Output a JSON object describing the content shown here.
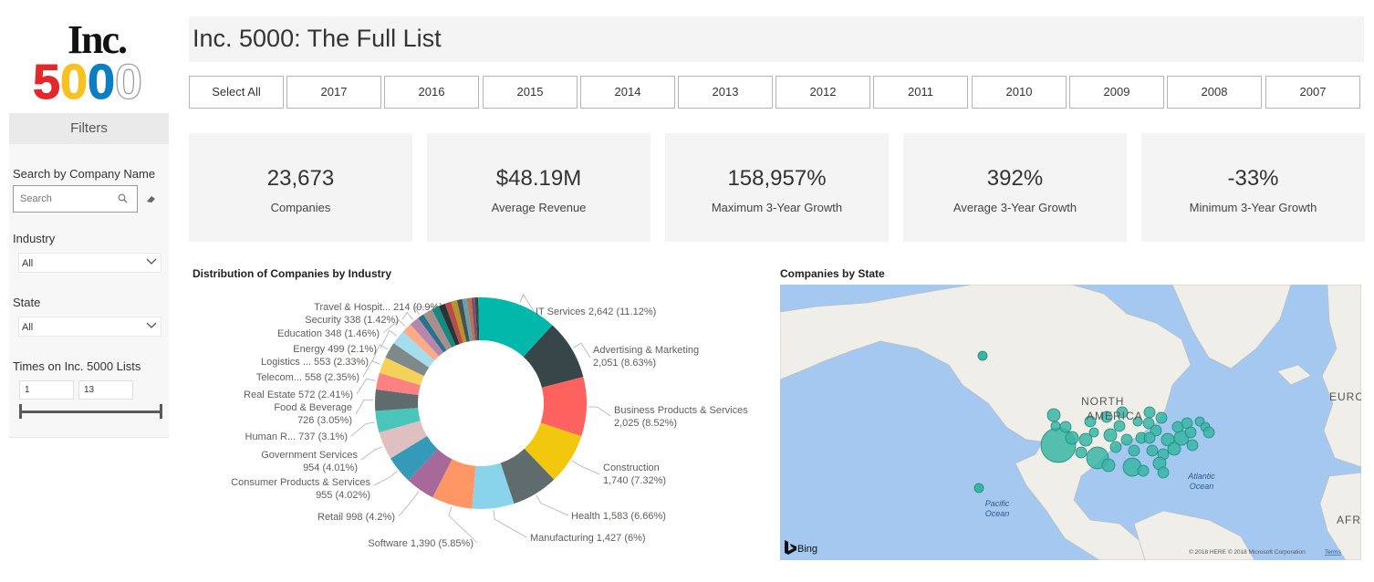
{
  "logo": {
    "line1": "Inc.",
    "line2": "5000",
    "colors": [
      "#e4262d",
      "#f7c221",
      "#0d7ec4",
      "#ffffff"
    ]
  },
  "sidebar": {
    "filters_title": "Filters",
    "search_label": "Search by Company Name",
    "search_placeholder": "Search",
    "industry_label": "Industry",
    "industry_value": "All",
    "state_label": "State",
    "state_value": "All",
    "times_label": "Times on Inc. 5000 Lists",
    "times_min": "1",
    "times_max": "13"
  },
  "header": {
    "title": "Inc. 5000: The Full List"
  },
  "year_filters": [
    "Select All",
    "2017",
    "2016",
    "2015",
    "2014",
    "2013",
    "2012",
    "2011",
    "2010",
    "2009",
    "2008",
    "2007"
  ],
  "kpis": [
    {
      "value": "23,673",
      "label": "Companies"
    },
    {
      "value": "$48.19M",
      "label": "Average Revenue"
    },
    {
      "value": "158,957%",
      "label": "Maximum 3-Year Growth"
    },
    {
      "value": "392%",
      "label": "Average 3-Year Growth"
    },
    {
      "value": "-33%",
      "label": "Minimum 3-Year Growth"
    }
  ],
  "industry_chart": {
    "title": "Distribution of Companies by Industry"
  },
  "state_map": {
    "title": "Companies by State",
    "labels": {
      "north_america": "NORTH AMERICA",
      "europe": "EURO",
      "africa": "AFR",
      "atlantic": "Atlantic Ocean",
      "pacific": "Pacific Ocean"
    },
    "attribution": "© 2018 HERE © 2018 Microsoft Corporation",
    "terms": "Terms",
    "bing": "Bing",
    "bubble_color": "#3ab5a4"
  },
  "chart_data": {
    "type": "pie",
    "variant": "donut",
    "total": 23673,
    "slices": [
      {
        "label": "IT Services",
        "value": 2642,
        "pct": "11.12%",
        "text": "IT Services 2,642 (11.12%)",
        "color": "#01b8aa"
      },
      {
        "label": "Advertising & Marketing",
        "value": 2051,
        "pct": "8.63%",
        "text": "Advertising & Marketing",
        "text2": "2,051 (8.63%)",
        "color": "#374649"
      },
      {
        "label": "Business Products & Services",
        "value": 2025,
        "pct": "8.52%",
        "text": "Business Products & Services",
        "text2": "2,025 (8.52%)",
        "color": "#fd625e"
      },
      {
        "label": "Construction",
        "value": 1740,
        "pct": "7.32%",
        "text": "Construction",
        "text2": "1,740 (7.32%)",
        "color": "#f2c80f"
      },
      {
        "label": "Health",
        "value": 1583,
        "pct": "6.66%",
        "text": "Health 1,583 (6.66%)",
        "color": "#5f6b6d"
      },
      {
        "label": "Manufacturing",
        "value": 1427,
        "pct": "6%",
        "text": "Manufacturing 1,427 (6%)",
        "color": "#8ad4eb"
      },
      {
        "label": "Software",
        "value": 1390,
        "pct": "5.85%",
        "text": "Software 1,390 (5.85%)",
        "color": "#fe9666"
      },
      {
        "label": "Retail",
        "value": 998,
        "pct": "4.2%",
        "text": "Retail 998 (4.2%)",
        "color": "#a66999"
      },
      {
        "label": "Consumer Products & Services",
        "value": 955,
        "pct": "4.02%",
        "text": "Consumer Products & Services",
        "text2": "955 (4.02%)",
        "color": "#3599b8"
      },
      {
        "label": "Government Services",
        "value": 954,
        "pct": "4.01%",
        "text": "Government Services",
        "text2": "954 (4.01%)",
        "color": "#dfbfbf"
      },
      {
        "label": "Human R...",
        "value": 737,
        "pct": "3.1%",
        "text": "Human R... 737 (3.1%)",
        "color": "#4ac5bb"
      },
      {
        "label": "Food & Beverage",
        "value": 726,
        "pct": "3.05%",
        "text": "Food & Beverage",
        "text2": "726 (3.05%)",
        "color": "#5f6b6d"
      },
      {
        "label": "Real Estate",
        "value": 572,
        "pct": "2.41%",
        "text": "Real Estate 572 (2.41%)",
        "color": "#fb8281"
      },
      {
        "label": "Telecom...",
        "value": 558,
        "pct": "2.35%",
        "text": "Telecom... 558 (2.35%)",
        "color": "#f4d25a"
      },
      {
        "label": "Logistics ...",
        "value": 553,
        "pct": "2.33%",
        "text": "Logistics ... 553 (2.33%)",
        "color": "#7f898a"
      },
      {
        "label": "Energy",
        "value": 499,
        "pct": "2.1%",
        "text": "Energy 499 (2.1%)",
        "color": "#a4ddee"
      },
      {
        "label": "Education",
        "value": 348,
        "pct": "1.46%",
        "text": "Education 348 (1.46%)",
        "color": "#fdab89"
      },
      {
        "label": "Security",
        "value": 338,
        "pct": "1.42%",
        "text": "Security 338 (1.42%)",
        "color": "#b687ac"
      },
      {
        "label": "Travel & Hospit...",
        "value": 214,
        "pct": "0.9%",
        "text": "Travel & Hospit... 214 (0.9%)",
        "color": "#28738a"
      },
      {
        "label": "",
        "value": 330,
        "color": "#a78f8f"
      },
      {
        "label": "",
        "value": 255,
        "color": "#168980"
      },
      {
        "label": "",
        "value": 230,
        "color": "#293537"
      },
      {
        "label": "",
        "value": 215,
        "color": "#bb4a4a"
      },
      {
        "label": "",
        "value": 200,
        "color": "#b59525"
      },
      {
        "label": "",
        "value": 180,
        "color": "#475052"
      },
      {
        "label": "",
        "value": 160,
        "color": "#6a9fb0"
      },
      {
        "label": "",
        "value": 150,
        "color": "#bd7150"
      },
      {
        "label": "",
        "value": 125,
        "color": "#7b4f71"
      },
      {
        "label": "",
        "value": 110,
        "color": "#374649"
      },
      {
        "label": "",
        "value": 87,
        "color": "#01b8aa"
      }
    ]
  }
}
